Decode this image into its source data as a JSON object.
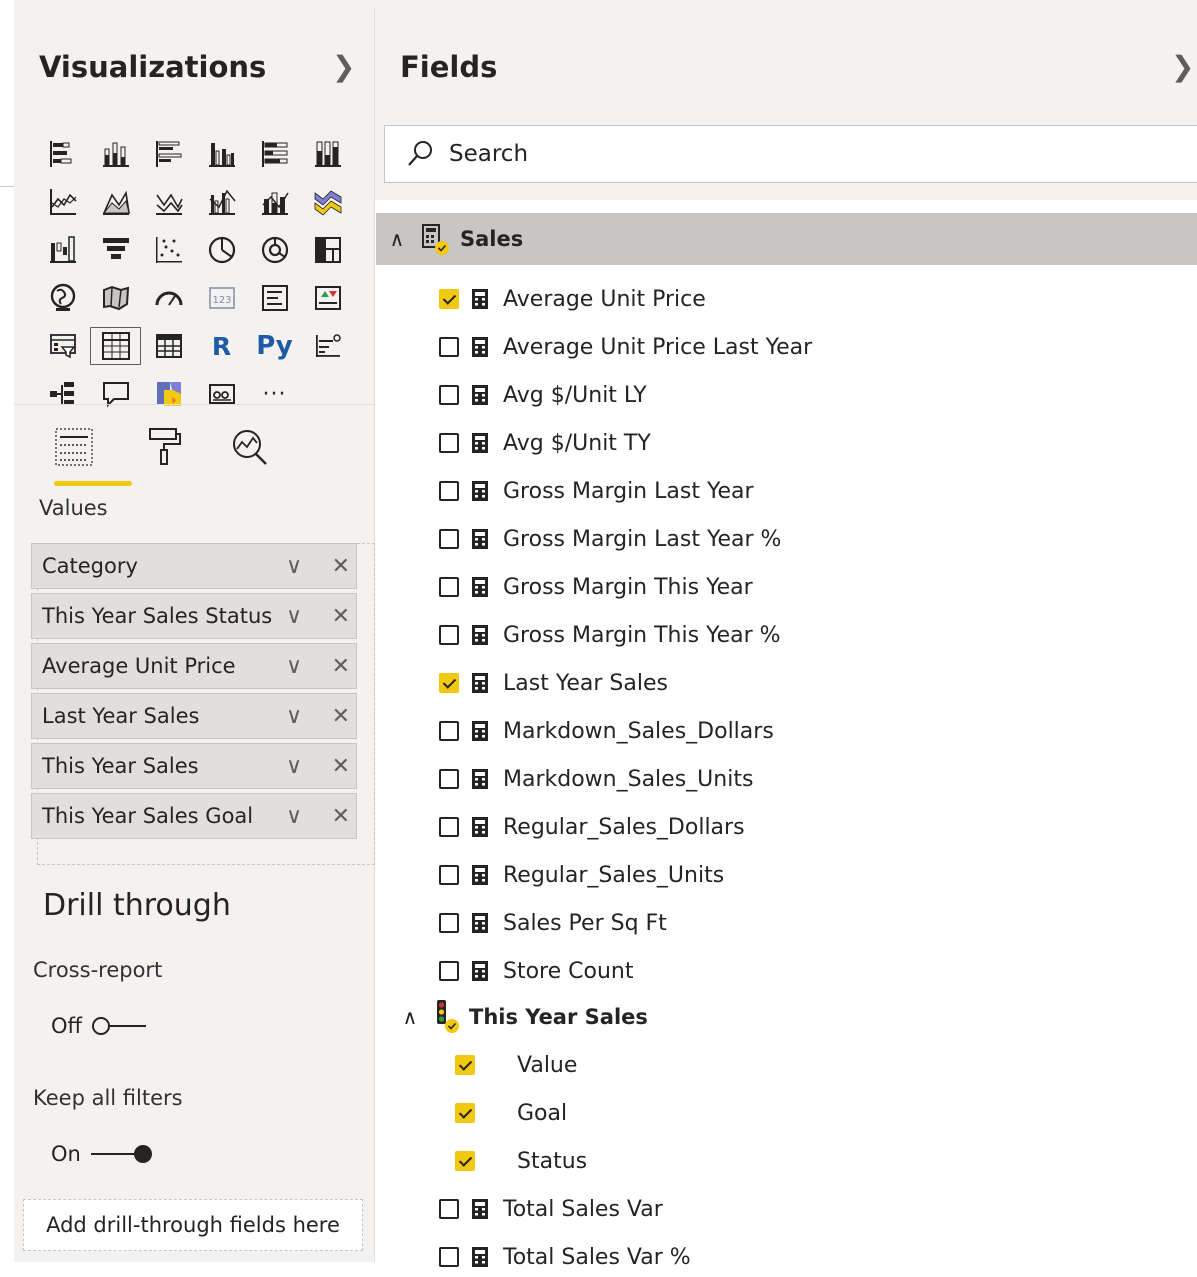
{
  "visualizations": {
    "title": "Visualizations",
    "icons": [
      [
        "stacked-bar-chart-icon",
        "stacked-column-chart-icon",
        "clustered-bar-chart-icon",
        "clustered-column-chart-icon",
        "100-stacked-bar-chart-icon",
        "100-stacked-column-chart-icon"
      ],
      [
        "line-chart-icon",
        "area-chart-icon",
        "stacked-area-chart-icon",
        "line-clustered-column-chart-icon",
        "line-stacked-column-chart-icon",
        "ribbon-chart-icon"
      ],
      [
        "waterfall-chart-icon",
        "funnel-chart-icon",
        "scatter-chart-icon",
        "pie-chart-icon",
        "donut-chart-icon",
        "treemap-icon"
      ],
      [
        "map-icon",
        "filled-map-icon",
        "gauge-icon",
        "card-icon",
        "multi-row-card-icon",
        "kpi-icon"
      ],
      [
        "slicer-icon",
        "table-icon",
        "matrix-icon",
        "r-visual-icon",
        "python-visual-icon",
        "key-influencers-icon"
      ],
      [
        "decomposition-tree-icon",
        "qa-icon",
        "shape-map-icon",
        "smart-narrative-icon",
        "more-visuals-icon"
      ]
    ],
    "r_label": "R",
    "py_label": "Py",
    "more_label": "···",
    "card_label": "123",
    "values_label": "Values",
    "wells": [
      "Category",
      "This Year Sales Status",
      "Average Unit Price",
      "Last Year Sales",
      "This Year Sales",
      "This Year Sales Goal"
    ],
    "drill_through": {
      "title": "Drill through",
      "cross_report_label": "Cross-report",
      "cross_report_state": "Off",
      "keep_filters_label": "Keep all filters",
      "keep_filters_state": "On",
      "add_fields": "Add drill-through fields here"
    },
    "colors": {
      "accent": "#f2c811",
      "pane_bg": "#f3f2f1",
      "well_bg": "#e1dfdd"
    }
  },
  "fields": {
    "title": "Fields",
    "search_placeholder": "Search",
    "table_name": "Sales",
    "items": [
      {
        "name": "Average Unit Price",
        "checked": true
      },
      {
        "name": "Average Unit Price Last Year",
        "checked": false
      },
      {
        "name": "Avg $/Unit LY",
        "checked": false
      },
      {
        "name": "Avg $/Unit TY",
        "checked": false
      },
      {
        "name": "Gross Margin Last Year",
        "checked": false
      },
      {
        "name": "Gross Margin Last Year %",
        "checked": false
      },
      {
        "name": "Gross Margin This Year",
        "checked": false
      },
      {
        "name": "Gross Margin This Year %",
        "checked": false
      },
      {
        "name": "Last Year Sales",
        "checked": true
      },
      {
        "name": "Markdown_Sales_Dollars",
        "checked": false
      },
      {
        "name": "Markdown_Sales_Units",
        "checked": false
      },
      {
        "name": "Regular_Sales_Dollars",
        "checked": false
      },
      {
        "name": "Regular_Sales_Units",
        "checked": false
      },
      {
        "name": "Sales Per Sq Ft",
        "checked": false
      },
      {
        "name": "Store Count",
        "checked": false
      }
    ],
    "kpi_group": {
      "name": "This Year Sales",
      "children": [
        {
          "name": "Value",
          "checked": true
        },
        {
          "name": "Goal",
          "checked": true
        },
        {
          "name": "Status",
          "checked": true
        }
      ]
    },
    "trailing_items": [
      {
        "name": "Total Sales Var",
        "checked": false
      },
      {
        "name": "Total Sales Var %",
        "checked": false
      }
    ]
  }
}
